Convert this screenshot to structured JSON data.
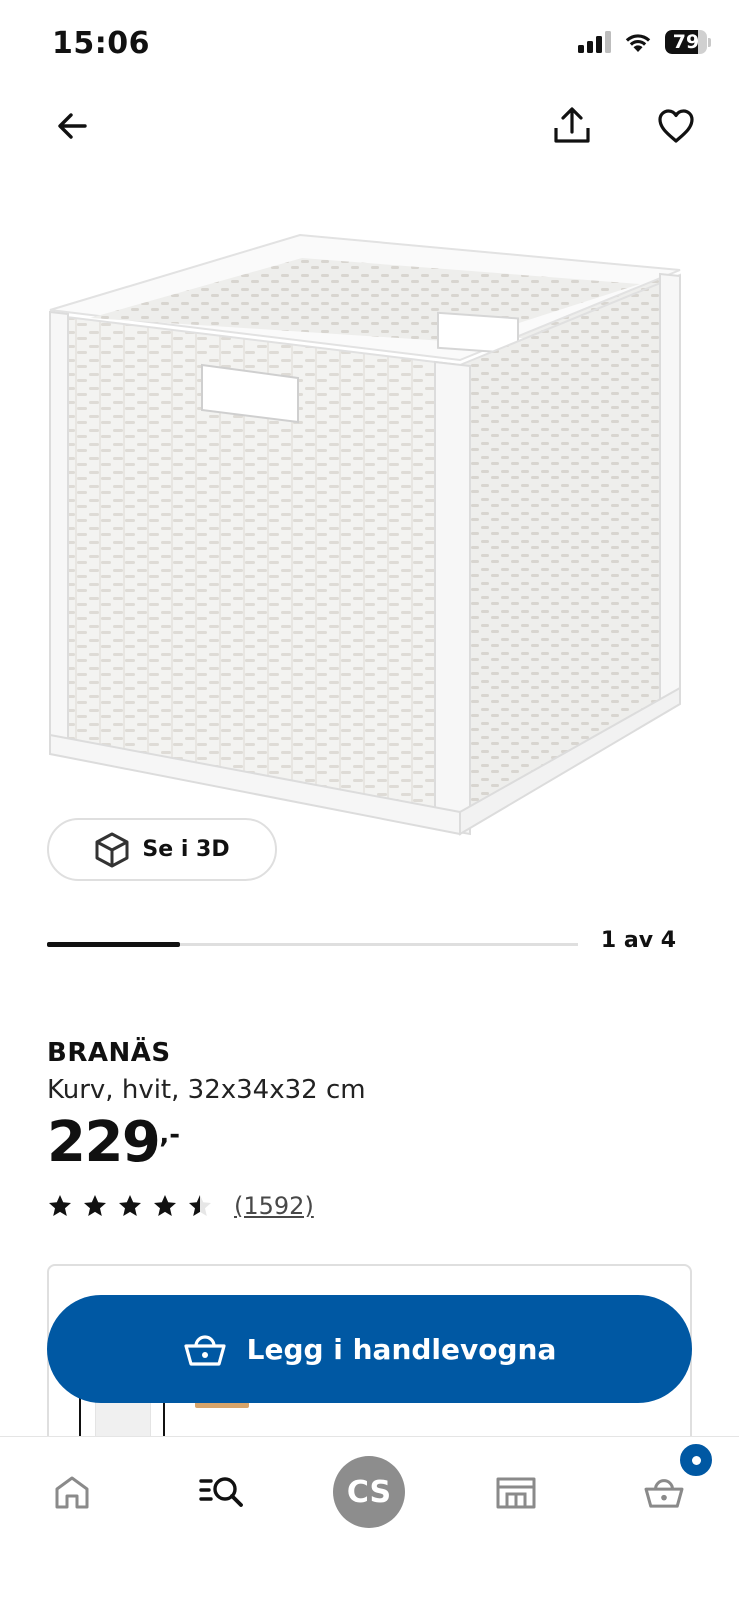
{
  "status_bar": {
    "time": "15:06",
    "battery": "79",
    "battery_level_percent": 79,
    "icons": [
      "signal-icon",
      "wifi-icon",
      "battery-icon"
    ]
  },
  "top_nav": {
    "icons": [
      "arrow-left-icon",
      "share-icon",
      "heart-icon"
    ]
  },
  "gallery": {
    "view_3d_label": "Se i 3D",
    "pager_text": "1 av 4",
    "current_image": 1,
    "total_images": 4
  },
  "product": {
    "name": "BRANÄS",
    "description": "Kurv, hvit, 32x34x32 cm",
    "price_integer": "229",
    "price_decimal": ",-",
    "rating_value": 4.5,
    "rating_max": 5,
    "rating_count": "(1592)"
  },
  "cart_button": {
    "label": "Legg i handlevogna",
    "icon": "basket-icon"
  },
  "bottom_nav": {
    "items": [
      "home-icon",
      "search-icon",
      "profile-avatar",
      "store-icon",
      "basket-icon"
    ],
    "avatar_initials": "CS"
  },
  "colors": {
    "primary_blue": "#0058a3",
    "text": "#111111",
    "avatar_gray": "#8d8d8d"
  }
}
